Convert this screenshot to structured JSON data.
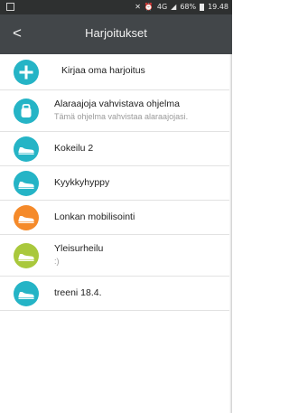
{
  "status": {
    "network": "4G",
    "battery": "68%",
    "time": "19.48"
  },
  "appbar": {
    "back_glyph": "<",
    "title": "Harjoitukset"
  },
  "colors": {
    "teal": "#25b4c6",
    "orange": "#f58a2a",
    "lime": "#a9c83c",
    "appbar": "#424649",
    "statusbar": "#2e3030"
  },
  "add": {
    "label": "Kirjaa oma harjoitus",
    "icon": "plus-icon"
  },
  "items": [
    {
      "label": "Alaraajoja vahvistava ohjelma",
      "subtitle": "Tämä ohjelma vahvistaa alaraajojasi.",
      "icon": "kettlebell-icon",
      "color": "#25b4c6"
    },
    {
      "label": "Kokeilu 2",
      "subtitle": "",
      "icon": "shoe-icon",
      "color": "#25b4c6"
    },
    {
      "label": "Kyykkyhyppy",
      "subtitle": "",
      "icon": "shoe-icon",
      "color": "#25b4c6"
    },
    {
      "label": "Lonkan mobilisointi",
      "subtitle": "",
      "icon": "shoe-icon",
      "color": "#f58a2a"
    },
    {
      "label": "Yleisurheilu",
      "subtitle": ":)",
      "icon": "shoe-icon",
      "color": "#a9c83c"
    },
    {
      "label": "treeni 18.4.",
      "subtitle": "",
      "icon": "shoe-icon",
      "color": "#25b4c6"
    }
  ]
}
